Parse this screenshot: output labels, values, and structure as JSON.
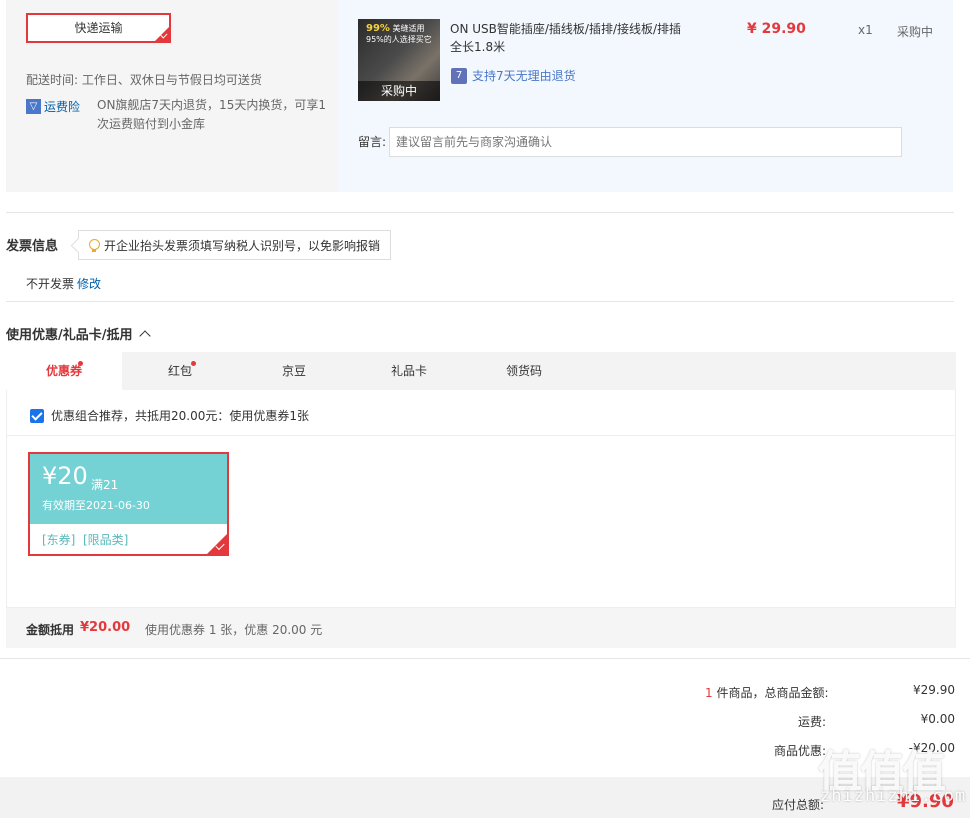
{
  "shipping": {
    "method": "快递运输",
    "delivery_time_label": "配送时间:",
    "delivery_time_value": "工作日、双休日与节假日均可送货",
    "freight_insurance_label": "运费险",
    "freight_insurance_desc": "ON旗舰店7天内退货，15天内换货，可享1次运费赔付到小金库"
  },
  "product": {
    "image_badge_highlight": "99%",
    "image_badge_line1": "美缝适用",
    "image_badge_line2": "95%的人选择买它",
    "image_status": "采购中",
    "name": "ON USB智能插座/插线板/插排/接线板/排插全长1.8米",
    "return_icon": "7",
    "return_policy": "支持7天无理由退货",
    "price": "¥ 29.90",
    "quantity": "x1",
    "status": "采购中"
  },
  "note": {
    "label": "留言:",
    "placeholder": "建议留言前先与商家沟通确认"
  },
  "invoice": {
    "title": "发票信息",
    "tip": "开企业抬头发票须填写纳税人识别号，以免影响报销",
    "value": "不开发票",
    "edit": "修改"
  },
  "coupons": {
    "title": "使用优惠/礼品卡/抵用",
    "tabs": [
      {
        "label": "优惠券",
        "dot": true,
        "active": true
      },
      {
        "label": "红包",
        "dot": true,
        "active": false
      },
      {
        "label": "京豆",
        "dot": false,
        "active": false
      },
      {
        "label": "礼品卡",
        "dot": false,
        "active": false
      },
      {
        "label": "领货码",
        "dot": false,
        "active": false
      }
    ],
    "combo_text": "优惠组合推荐，共抵用20.00元：使用优惠券1张",
    "card": {
      "amount": "¥20",
      "condition": "满21",
      "valid": "有效期至2021-06-30",
      "tags": "[东券]  [限品类]"
    },
    "discount_label": "金额抵用",
    "discount_amount": "¥20.00",
    "discount_desc": "使用优惠券 1 张，优惠 20.00 元"
  },
  "summary": {
    "count": "1",
    "count_suffix": "件商品，总商品金额:",
    "total": "¥29.90",
    "freight_label": "运费:",
    "freight": "¥0.00",
    "discount_label": "商品优惠:",
    "discount": "-¥20.00",
    "pay_label": "应付总额:",
    "pay": "¥9.90"
  },
  "watermark": {
    "logo": "值值值",
    "text": "zhizhizhi.com"
  },
  "colors": {
    "accent": "#e4393c",
    "link": "#005ea7",
    "coupon": "#74d2d4"
  }
}
